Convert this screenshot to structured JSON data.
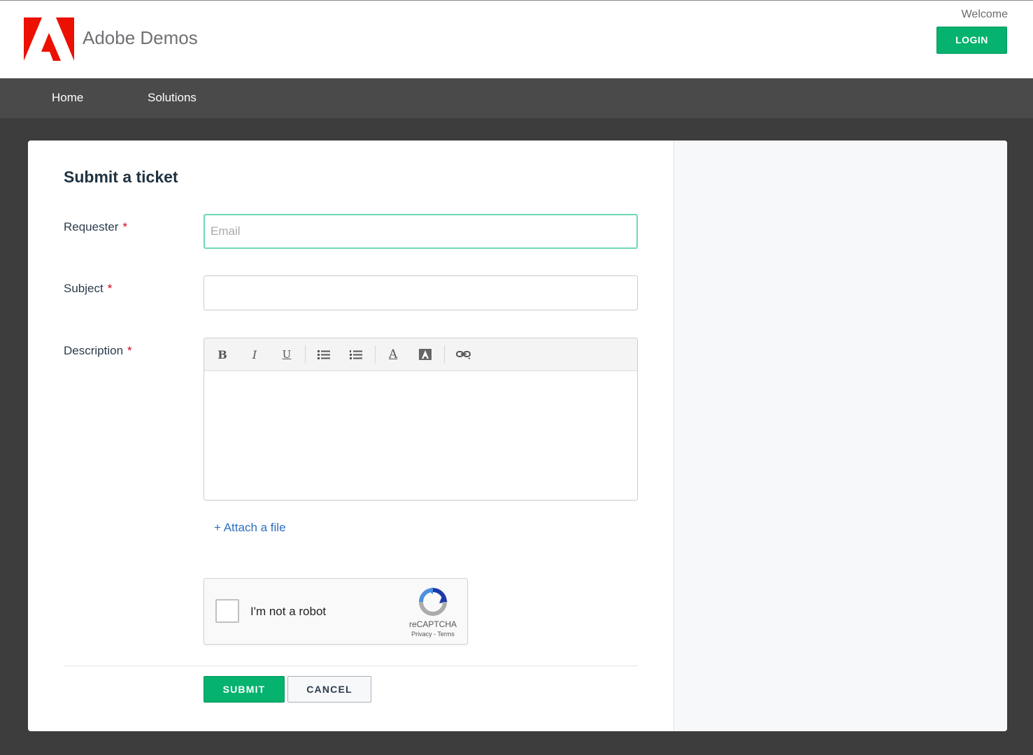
{
  "header": {
    "brand": "Adobe Demos",
    "welcome": "Welcome",
    "login_label": "LOGIN"
  },
  "nav": {
    "items": [
      {
        "label": "Home"
      },
      {
        "label": "Solutions"
      }
    ]
  },
  "form": {
    "title": "Submit a ticket",
    "requester": {
      "label": "Requester",
      "required_mark": "*",
      "placeholder": "Email",
      "value": ""
    },
    "subject": {
      "label": "Subject",
      "required_mark": "*",
      "value": ""
    },
    "description": {
      "label": "Description",
      "required_mark": "*",
      "value": "",
      "toolbar": {
        "bold": "B",
        "italic": "I",
        "underline": "U",
        "font_color": "A"
      }
    },
    "attach_label": "+ Attach a file",
    "captcha": {
      "text": "I'm not a robot",
      "brand": "reCAPTCHA",
      "links": "Privacy - Terms",
      "checked": false
    },
    "submit_label": "SUBMIT",
    "cancel_label": "CANCEL"
  },
  "colors": {
    "accent_green": "#05b26e",
    "nav_bg": "#4a4a4a",
    "page_bg": "#3d3d3d",
    "link_blue": "#2d6fc1",
    "required_red": "#d0021b",
    "adobe_red": "#eb1000"
  }
}
